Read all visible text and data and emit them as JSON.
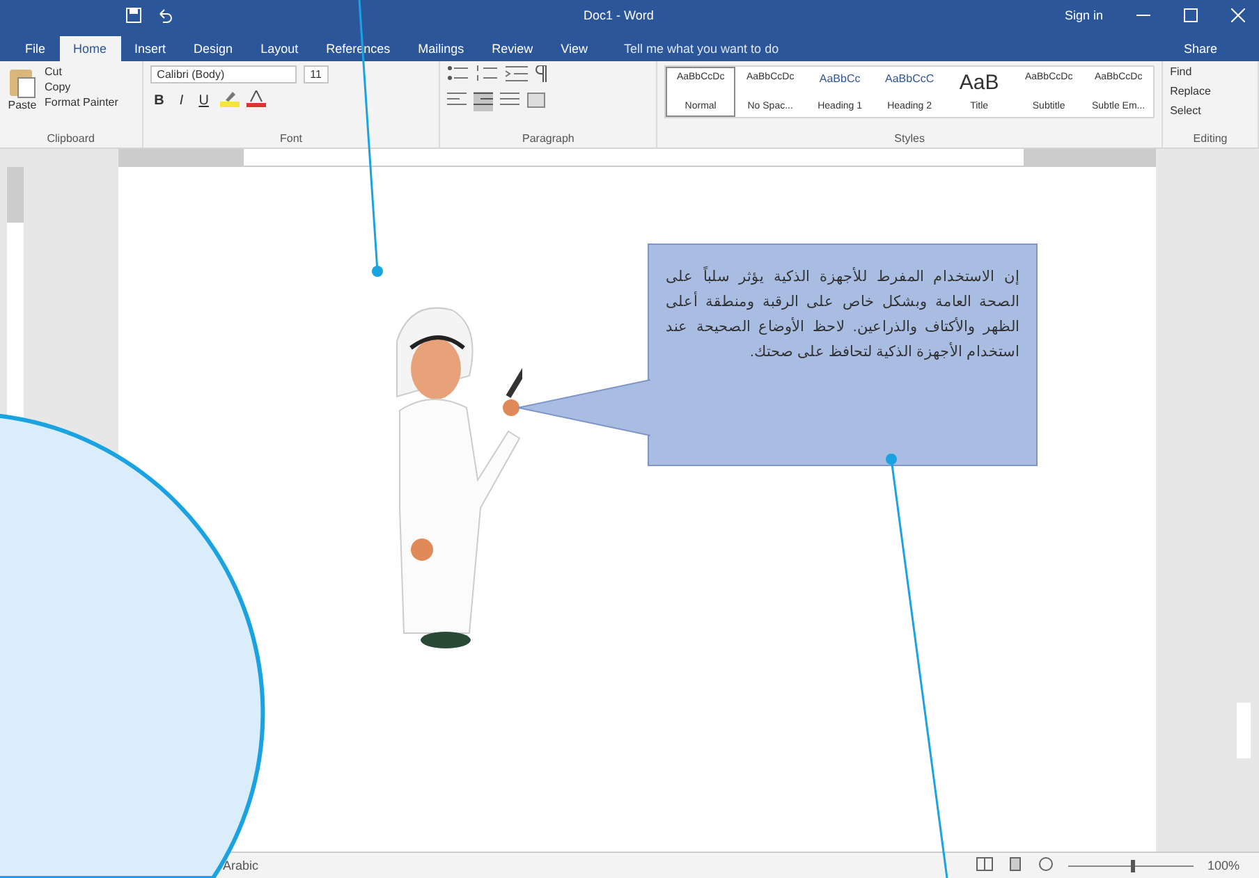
{
  "window": {
    "title": "Doc1 - Word",
    "sign_in": "Sign in"
  },
  "tabs": [
    {
      "label": "File",
      "selected": false
    },
    {
      "label": "Home",
      "selected": true
    },
    {
      "label": "Insert",
      "selected": false
    },
    {
      "label": "Design",
      "selected": false
    },
    {
      "label": "Layout",
      "selected": false
    },
    {
      "label": "References",
      "selected": false
    },
    {
      "label": "Mailings",
      "selected": false
    },
    {
      "label": "Review",
      "selected": false
    },
    {
      "label": "View",
      "selected": false
    }
  ],
  "tell_me": {
    "placeholder": "Tell me what you want to do"
  },
  "share": "Share",
  "clipboard": {
    "paste": "Paste",
    "cut": "Cut",
    "copy": "Copy",
    "format_painter": "Format Painter",
    "label": "Clipboard"
  },
  "font": {
    "name": "Calibri (Body)",
    "size": "11",
    "format_buttons": [
      "B",
      "I",
      "U"
    ],
    "label": "Font"
  },
  "paragraph": {
    "label": "Paragraph"
  },
  "styles": {
    "items": [
      {
        "sample": "AaBbCcDc",
        "name": "Normal",
        "selected": true,
        "kind": "body"
      },
      {
        "sample": "AaBbCcDc",
        "name": "No Spac...",
        "selected": false,
        "kind": "body"
      },
      {
        "sample": "AaBbCc",
        "name": "Heading 1",
        "selected": false,
        "kind": "heading"
      },
      {
        "sample": "AaBbCcC",
        "name": "Heading 2",
        "selected": false,
        "kind": "heading"
      },
      {
        "sample": "AaB",
        "name": "Title",
        "selected": false,
        "kind": "title"
      },
      {
        "sample": "AaBbCcDc",
        "name": "Subtitle",
        "selected": false,
        "kind": "body"
      },
      {
        "sample": "AaBbCcDc",
        "name": "Subtle Em...",
        "selected": false,
        "kind": "body"
      }
    ],
    "label": "Styles"
  },
  "editing": {
    "items": [
      "Find",
      "Replace",
      "Select"
    ],
    "label": "Editing"
  },
  "document": {
    "callout_text": "إن الاستخدام المفرط للأجهزة الذكية يؤثر سلباً على الصحة العامة وبشكل خاص على الرقبة ومنطقة أعلى الظهر والأكتاف والذراعين. لاحظ الأوضاع الصحيحة عند استخدام الأجهزة الذكية لتحافظ على صحتك."
  },
  "status_bar": {
    "language": "Arabic",
    "zoom": "100%",
    "level": 0.5
  }
}
